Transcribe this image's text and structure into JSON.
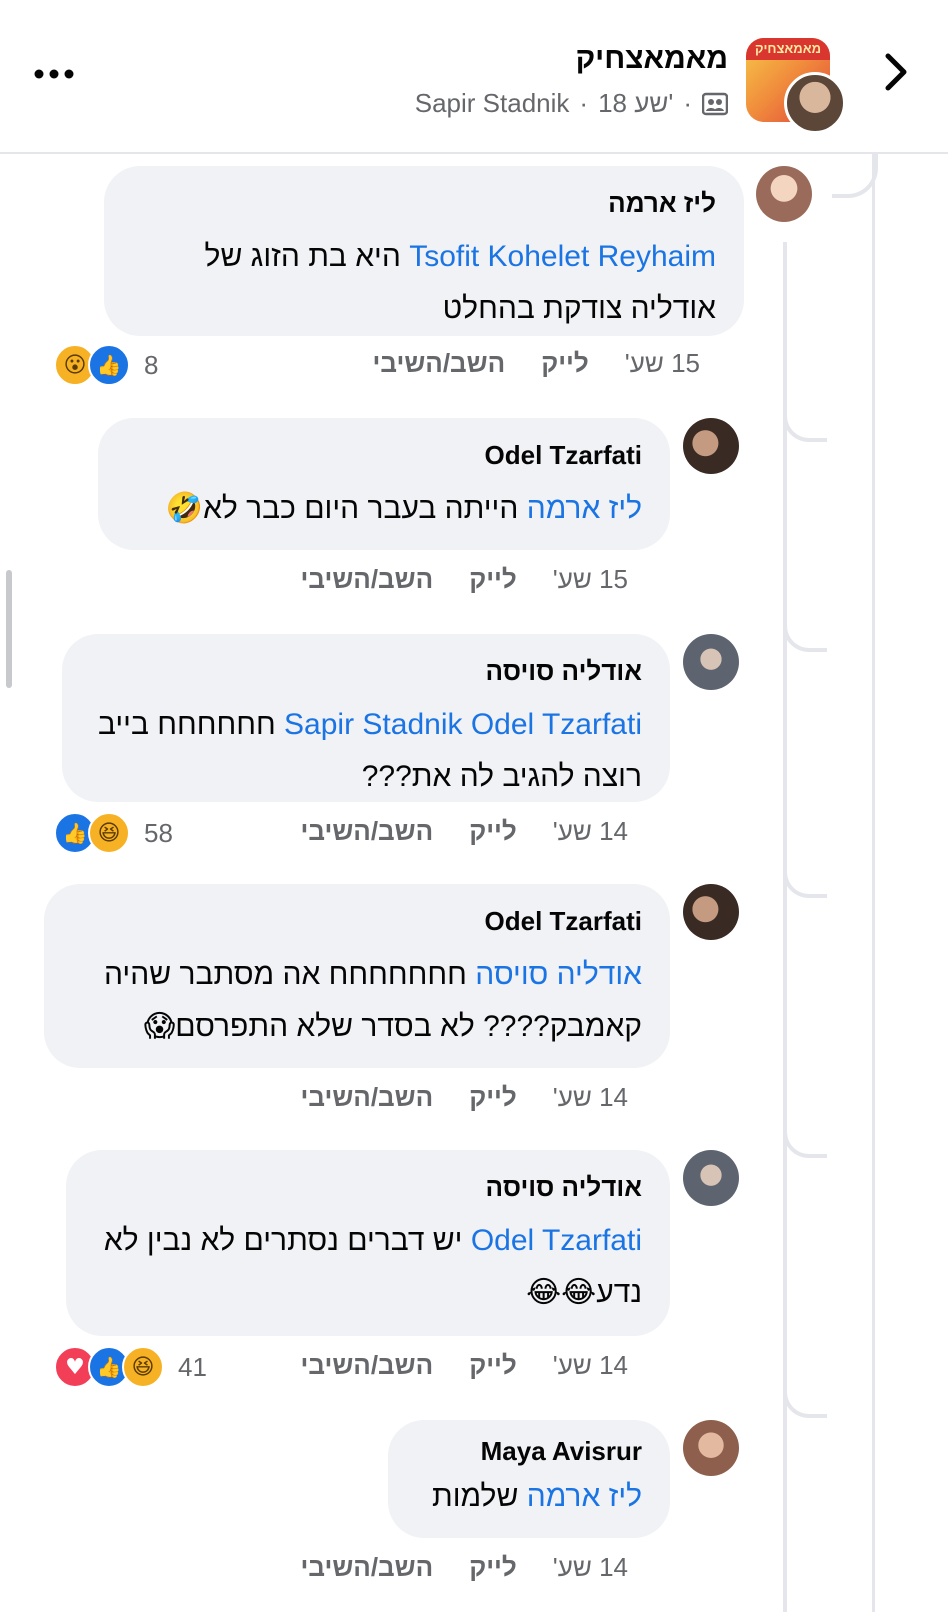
{
  "header": {
    "group_name": "מאמאצחיק",
    "author": "Sapir Stadnik",
    "time": "18 שע'",
    "separator": "·",
    "group_avatar_text": "מאמאצחיק",
    "more_icon": "more-horizontal-icon",
    "back_icon": "chevron-right-icon"
  },
  "colors": {
    "link": "#1b74e4",
    "bubble": "#f0f2f5",
    "secondary_text": "#65676b",
    "like": "#1b74e4",
    "love": "#f33e58",
    "haha": "#f7b125"
  },
  "labels": {
    "like": "לייק",
    "reply": "השב/השיבי"
  },
  "comments": [
    {
      "author": "ליז ארמה",
      "mention": "Tsofit Kohelet Reyhaim",
      "text": " היא בת הזוג של אודליה צודקת בהחלט",
      "emoji": "",
      "time": "15 שע'",
      "reaction_count": "8",
      "reactions": [
        "like",
        "wow"
      ]
    },
    {
      "author": "Odel Tzarfati",
      "mention": "ליז ארמה",
      "text": " הייתה בעבר היום כבר לא",
      "emoji": "🤣",
      "time": "15 שע'",
      "reaction_count": "",
      "reactions": []
    },
    {
      "author": "אודליה סויסה",
      "mention": "Sapir Stadnik Odel Tzarfati",
      "text": " חחחחחח בייב רוצה להגיב לה את???",
      "emoji": "",
      "time": "14 שע'",
      "reaction_count": "58",
      "reactions": [
        "haha",
        "like"
      ]
    },
    {
      "author": "Odel Tzarfati",
      "mention": "אודליה סויסה",
      "text": " חחחחחחח אה מסתבר שהיה קאמבק???? לא בסדר שלא התפרסם",
      "emoji": "😱",
      "time": "14 שע'",
      "reaction_count": "",
      "reactions": []
    },
    {
      "author": "אודליה סויסה",
      "mention": "Odel Tzarfati",
      "text": " יש דברים נסתרים לא נבין לא נדע",
      "emoji": "😂😂",
      "time": "14 שע'",
      "reaction_count": "41",
      "reactions": [
        "haha",
        "like",
        "love"
      ]
    },
    {
      "author": "Maya Avisrur",
      "mention": "ליז ארמה",
      "text": " שלמות",
      "emoji": "",
      "time": "14 שע'",
      "reaction_count": "",
      "reactions": []
    }
  ]
}
